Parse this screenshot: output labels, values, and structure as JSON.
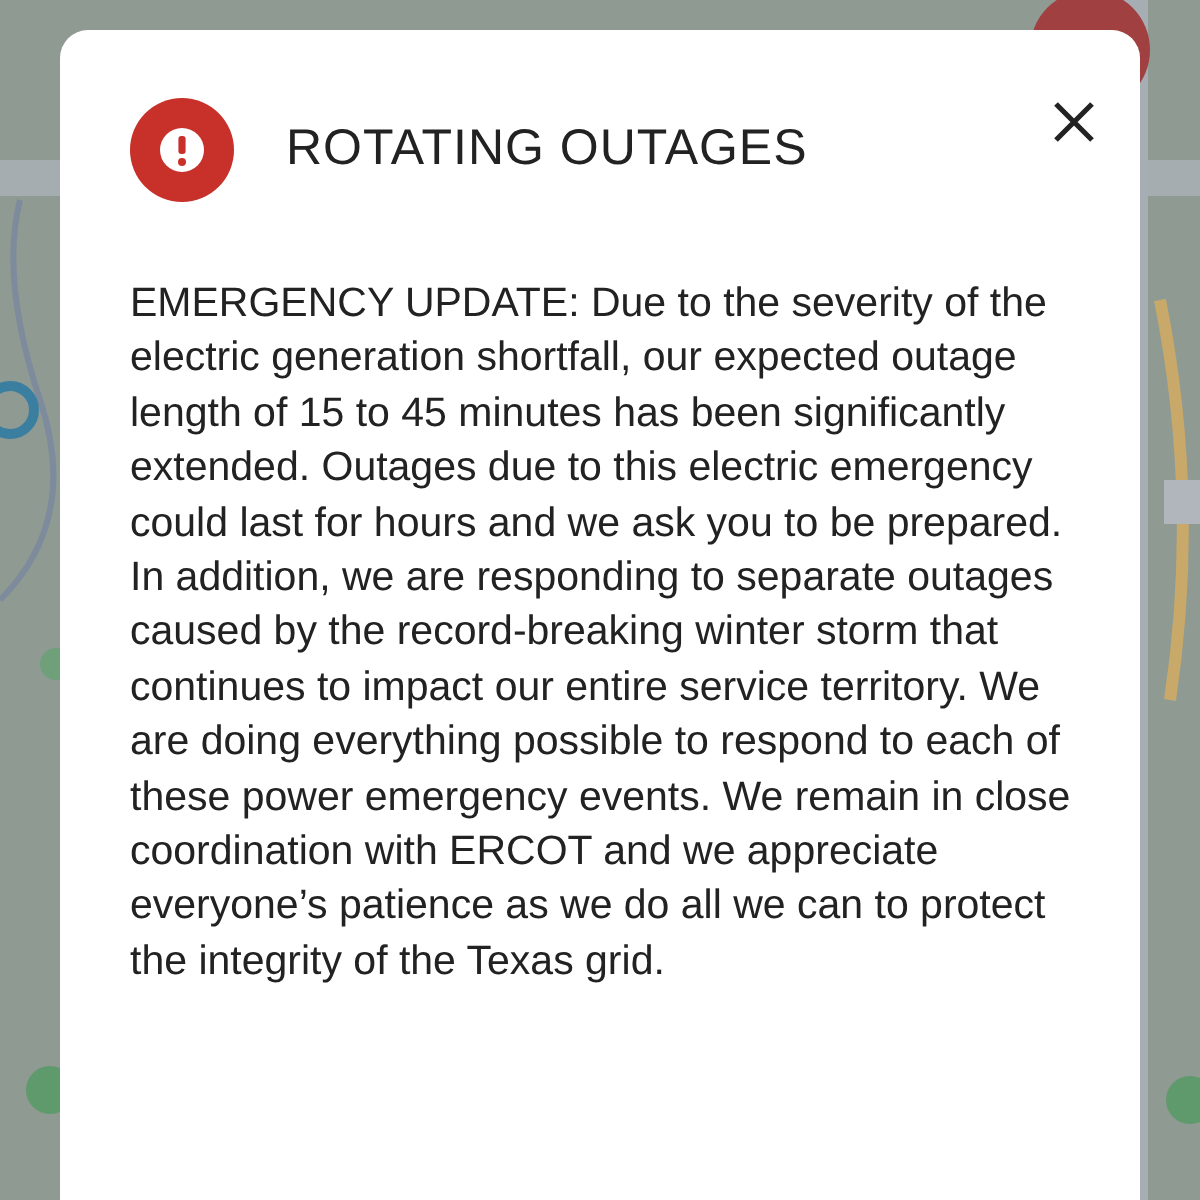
{
  "dialog": {
    "title": "ROTATING OUTAGES",
    "message": "EMERGENCY UPDATE: Due to the severity of the electric generation shortfall, our expected outage length of 15 to 45 minutes has been significantly extended. Outages due to this electric emergency could last for hours and we ask you to be prepared. In addition, we are responding to separate outages caused by the record-breaking winter storm that continues to impact our entire service territory. We are doing everything possible to respond to each of these power emergency events. We remain in close coordination with ERCOT and we appreciate everyone’s patience as we do all we can to protect the integrity of the Texas grid."
  }
}
